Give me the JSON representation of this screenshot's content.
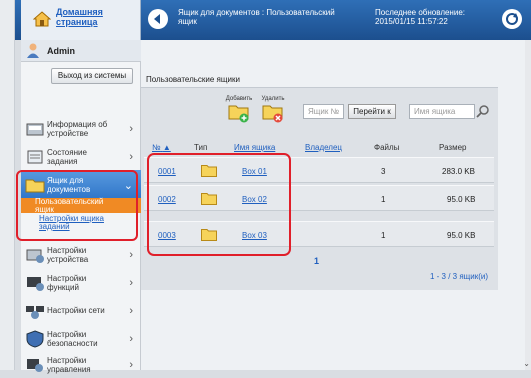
{
  "header": {
    "home_label_line1": "Домашняя",
    "home_label_line2": "страница",
    "breadcrumb_line1": "Ящик для документов : Пользовательский",
    "breadcrumb_line2": "ящик",
    "updated_line1": "Последнее обновление:",
    "updated_line2": "2015/01/15 11:57:22"
  },
  "sidebar": {
    "user": "Admin",
    "logout_label": "Выход из системы",
    "items": [
      {
        "line1": "Информация об",
        "line2": "устройстве"
      },
      {
        "line1": "Состояние",
        "line2": "задания"
      },
      {
        "line1": "Ящик для",
        "line2": "документов"
      },
      {
        "line1": "Настройки",
        "line2": "устройства"
      },
      {
        "line1": "Настройки",
        "line2": "функций"
      },
      {
        "line1": "Настройки сети",
        "line2": ""
      },
      {
        "line1": "Настройки",
        "line2": "безопасности"
      },
      {
        "line1": "Настройки",
        "line2": "управления"
      }
    ],
    "sub_selected_line1": "Пользовательский",
    "sub_selected_line2": "ящик",
    "sub_link_line1": "Настройки ящика",
    "sub_link_line2": "заданий"
  },
  "main": {
    "panel_title": "Пользовательские ящики",
    "add_label": "Добавить",
    "delete_label": "Удалить",
    "search_no_placeholder": "Ящик №",
    "goto_label": "Перейти к",
    "search_name_placeholder": "Имя ящика",
    "columns": {
      "no": "№",
      "sort_arrow": "▲",
      "type": "Тип",
      "name": "Имя ящика",
      "owner": "Владелец",
      "files": "Файлы",
      "size": "Размер"
    },
    "rows": [
      {
        "no": "0001",
        "name": "Box 01",
        "owner": "",
        "files": "3",
        "size": "283.0 KB"
      },
      {
        "no": "0002",
        "name": "Box 02",
        "owner": "",
        "files": "1",
        "size": "95.0 KB"
      },
      {
        "no": "0003",
        "name": "Box 03",
        "owner": "",
        "files": "1",
        "size": "95.0 KB"
      }
    ],
    "page": "1",
    "count": "1 - 3 / 3 ящик(и)"
  },
  "colors": {
    "accent": "#2f6fb7",
    "highlight": "#e01f2a",
    "selected": "#f08a24",
    "link": "#1f5fbf"
  }
}
